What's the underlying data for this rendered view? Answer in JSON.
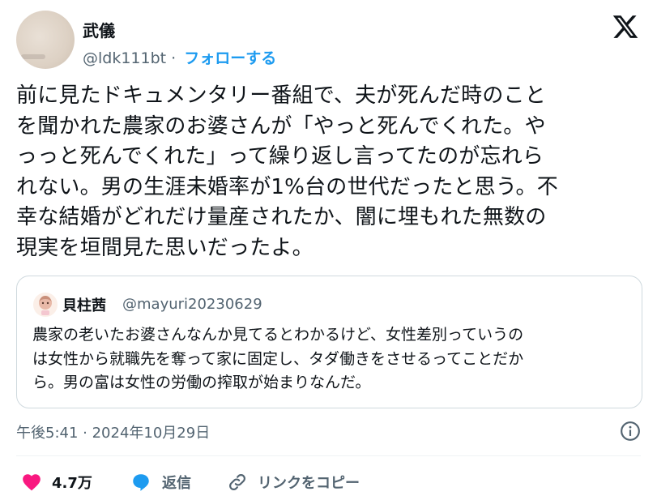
{
  "author": {
    "name": "武儀",
    "handle": "@ldk111bt",
    "separator": "·",
    "follow_label": "フォローする"
  },
  "tweet": {
    "lines": [
      "前に見たドキュメンタリー番組で、夫が死んだ時のこと",
      "を聞かれた農家のお婆さんが「やっと死んでくれた。や",
      "っっと死んでくれた」って繰り返し言ってたのが忘れら",
      "れない。男の生涯未婚率が1%台の世代だったと思う。不",
      "幸な結婚がどれだけ量産されたか、闇に埋もれた無数の",
      "現実を垣間見た思いだったよ。"
    ]
  },
  "quote": {
    "name": "貝柱茜",
    "handle": "@mayuri20230629",
    "lines": [
      "農家の老いたお婆さんなんか見てるとわかるけど、女性差別っていうの",
      "は女性から就職先を奪って家に固定し、タダ働きをさせるってことだか",
      "ら。男の富は女性の労働の搾取が始まりなんだ。"
    ]
  },
  "timestamp": "午後5:41 · 2024年10月29日",
  "actions": {
    "like_count": "4.7万",
    "reply_label": "返信",
    "copy_link_label": "リンクをコピー"
  },
  "colors": {
    "accent": "#1d9bf0",
    "like": "#f91880",
    "secondary_text": "#536471",
    "border": "#cfd9de"
  },
  "icons": [
    "x-logo-icon",
    "info-icon",
    "heart-icon",
    "reply-bubble-icon",
    "link-icon"
  ]
}
